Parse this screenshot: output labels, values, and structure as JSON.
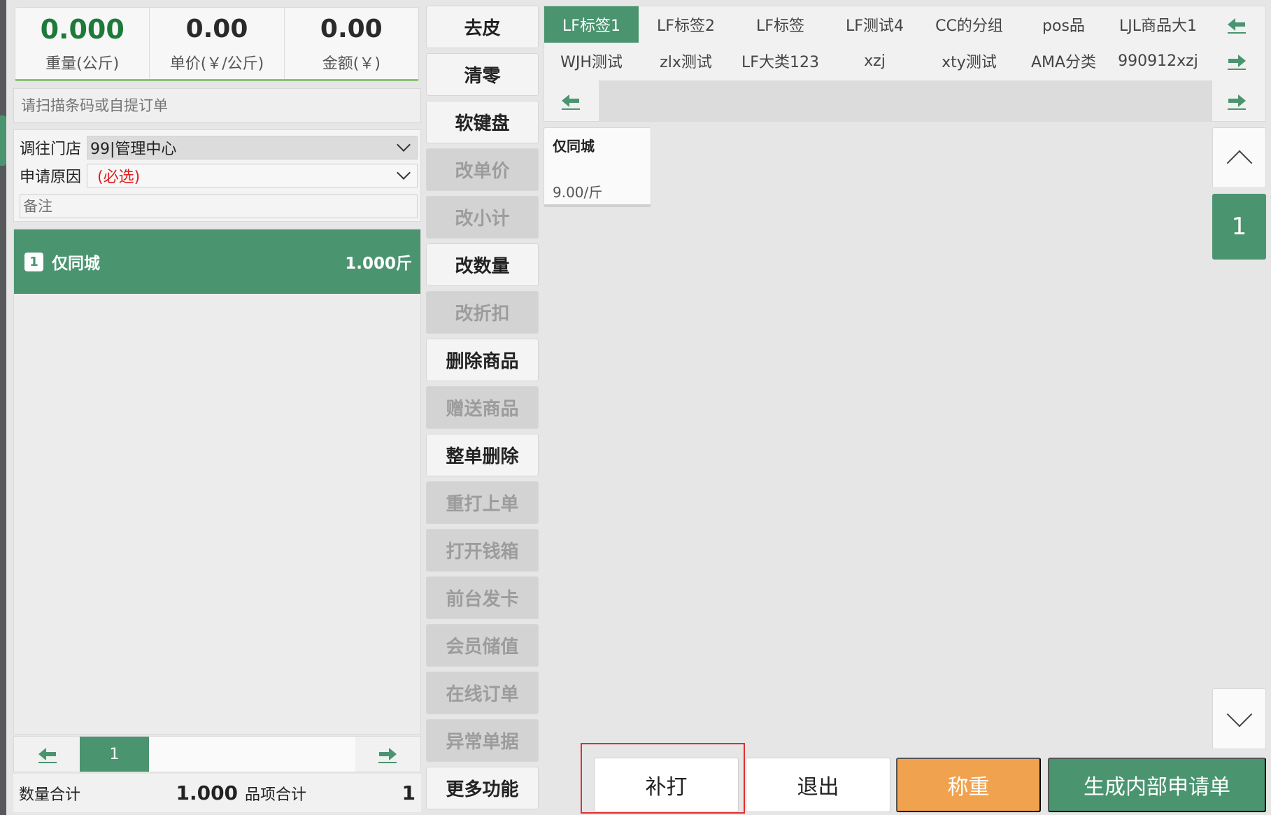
{
  "scale": {
    "weight": {
      "value": "0.000",
      "label": "重量(公斤)"
    },
    "unit_price": {
      "value": "0.00",
      "label": "单价(￥/公斤)"
    },
    "amount": {
      "value": "0.00",
      "label": "金额(￥)"
    }
  },
  "scan": {
    "placeholder": "请扫描条码或自提订单"
  },
  "form": {
    "store_label": "调往门店",
    "store_value": "99|管理中心",
    "reason_label": "申请原因",
    "reason_value": "(必选)",
    "remark_placeholder": "备注"
  },
  "order_items": [
    {
      "index": "1",
      "name": "仅同城",
      "qty": "1.000斤"
    }
  ],
  "pager": {
    "page": "1"
  },
  "totals": {
    "qty_label": "数量合计",
    "qty_value": "1.000",
    "count_label": "品项合计",
    "count_value": "1"
  },
  "functions": [
    {
      "label": "去皮",
      "enabled": true
    },
    {
      "label": "清零",
      "enabled": true
    },
    {
      "label": "软键盘",
      "enabled": true
    },
    {
      "label": "改单价",
      "enabled": false
    },
    {
      "label": "改小计",
      "enabled": false
    },
    {
      "label": "改数量",
      "enabled": true
    },
    {
      "label": "改折扣",
      "enabled": false
    },
    {
      "label": "删除商品",
      "enabled": true
    },
    {
      "label": "赠送商品",
      "enabled": false
    },
    {
      "label": "整单删除",
      "enabled": true
    },
    {
      "label": "重打上单",
      "enabled": false
    },
    {
      "label": "打开钱箱",
      "enabled": false
    },
    {
      "label": "前台发卡",
      "enabled": false
    },
    {
      "label": "会员储值",
      "enabled": false
    },
    {
      "label": "在线订单",
      "enabled": false
    },
    {
      "label": "异常单据",
      "enabled": false
    },
    {
      "label": "更多功能",
      "enabled": true
    }
  ],
  "categories": {
    "row1": [
      "LF标签1",
      "LF标签2",
      "LF标签",
      "LF测试4",
      "CC的分组",
      "pos品",
      "LJL商品大1"
    ],
    "row2": [
      "WJH测试",
      "zlx测试",
      "LF大类123",
      "xzj",
      "xty测试",
      "AMA分类",
      "990912xzj"
    ],
    "active": "LF标签1"
  },
  "products": [
    {
      "name": "仅同城",
      "price": "9.00/斤"
    }
  ],
  "product_page": "1",
  "actions": {
    "reprint": "补打",
    "exit": "退出",
    "weigh": "称重",
    "generate": "生成内部申请单"
  },
  "colors": {
    "accent_green": "#4a9470",
    "weigh_orange": "#f0a24f",
    "highlight_red": "#e03030"
  }
}
